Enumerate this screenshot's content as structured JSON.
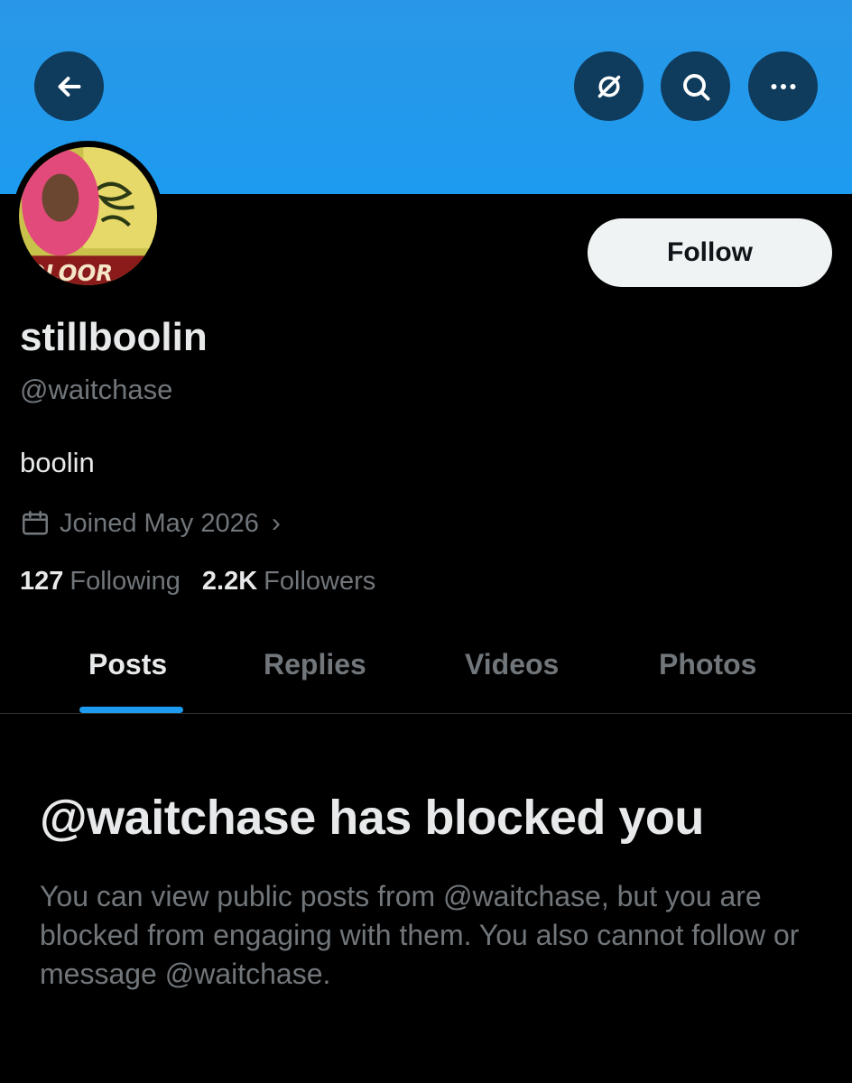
{
  "colors": {
    "accent": "#1d9bf0",
    "banner": "#1d9bf0",
    "background": "#000000",
    "text": "#e7e9ea",
    "muted": "#71767b",
    "follow_bg": "#eff3f4"
  },
  "header": {
    "back_icon": "arrow-left-icon",
    "grok_icon": "grok-icon",
    "search_icon": "search-icon",
    "more_icon": "more-horizontal-icon"
  },
  "profile": {
    "avatar_text": "OLOOR",
    "follow_label": "Follow",
    "display_name": "stillboolin",
    "handle": "@waitchase",
    "bio": "boolin",
    "joined": "Joined May 2026",
    "following_count": "127",
    "following_label": "Following",
    "followers_count": "2.2K",
    "followers_label": "Followers"
  },
  "tabs": [
    {
      "label": "Posts",
      "active": true
    },
    {
      "label": "Replies",
      "active": false
    },
    {
      "label": "Videos",
      "active": false
    },
    {
      "label": "Photos",
      "active": false
    }
  ],
  "blocked": {
    "title": "@waitchase has blocked you",
    "message": "You can view public posts from @waitchase, but you are blocked from engaging with them. You also cannot follow or message @waitchase."
  }
}
